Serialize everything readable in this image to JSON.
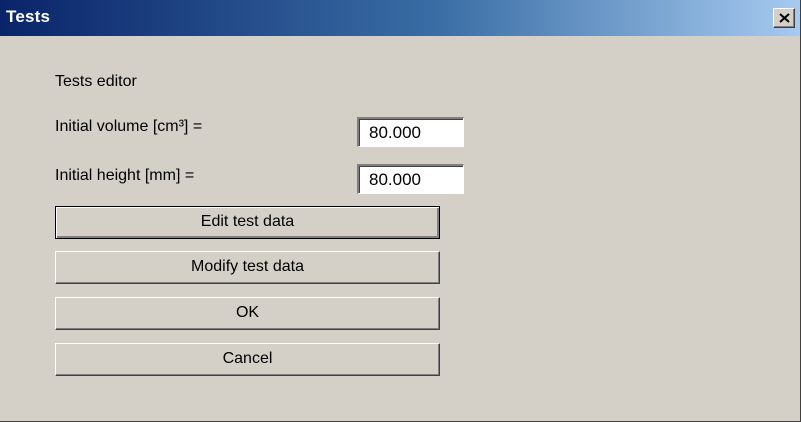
{
  "window": {
    "title": "Tests"
  },
  "dialog": {
    "section_label": "Tests editor",
    "fields": [
      {
        "label": "Initial volume [cm³] =",
        "value": "80.000"
      },
      {
        "label": "Initial height [mm] =",
        "value": "80.000"
      }
    ],
    "buttons": {
      "edit": "Edit test data",
      "modify": "Modify test data",
      "ok": "OK",
      "cancel": "Cancel"
    }
  },
  "icons": {
    "close": "close-icon"
  },
  "colors": {
    "titlebar_start": "#0a246a",
    "titlebar_end": "#a6caf0",
    "dialog_background": "#d4d0c8"
  }
}
